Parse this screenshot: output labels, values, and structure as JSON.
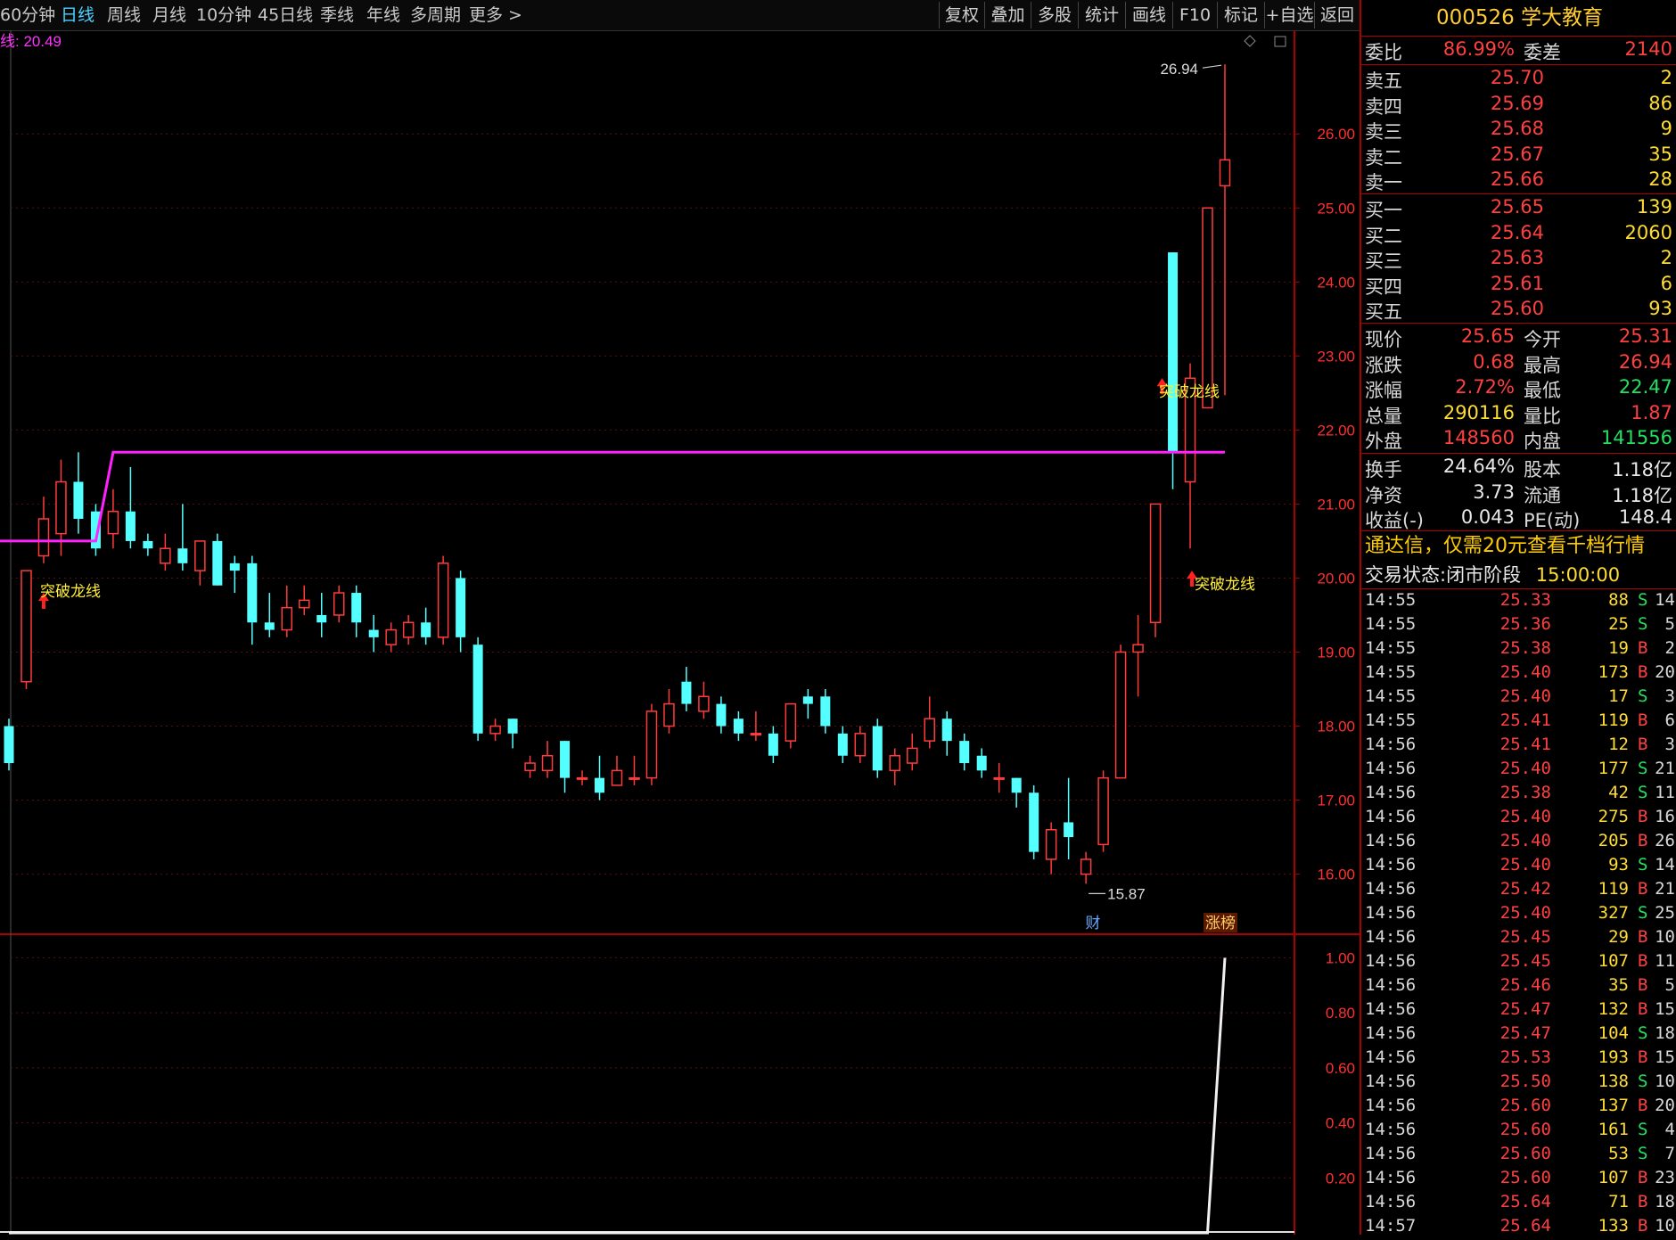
{
  "toolbar": {
    "tabs": [
      "60分钟",
      "日线",
      "周线",
      "月线",
      "10分钟",
      "45日线",
      "季线",
      "年线",
      "多周期",
      "更多 >"
    ],
    "active_tab": "日线",
    "buttons": [
      "复权",
      "叠加",
      "多股",
      "统计",
      "画线",
      "F10",
      "标记",
      "+自选",
      "返回"
    ]
  },
  "overlay_label": "线: 20.49",
  "chart_data": {
    "type": "candlestick",
    "price_axis_ticks": [
      "26.00",
      "25.00",
      "24.00",
      "23.00",
      "22.00",
      "21.00",
      "20.00",
      "19.00",
      "18.00",
      "17.00",
      "16.00"
    ],
    "ylim": [
      15.2,
      27.4
    ],
    "high_label": "26.94",
    "low_label": "15.87",
    "dragon_line_label": "突破龙线",
    "dragon_line": {
      "before": 20.5,
      "after": 21.7
    },
    "candles": [
      [
        18.0,
        17.5,
        18.1,
        17.4
      ],
      [
        18.6,
        20.1,
        20.1,
        18.5
      ],
      [
        20.3,
        20.8,
        21.1,
        20.2
      ],
      [
        20.6,
        21.3,
        21.6,
        20.3
      ],
      [
        21.3,
        20.8,
        21.7,
        20.6
      ],
      [
        20.9,
        20.4,
        21.0,
        20.3
      ],
      [
        20.6,
        20.9,
        21.2,
        20.4
      ],
      [
        20.9,
        20.5,
        21.5,
        20.4
      ],
      [
        20.5,
        20.4,
        20.6,
        20.3
      ],
      [
        20.2,
        20.4,
        20.6,
        20.1
      ],
      [
        20.4,
        20.2,
        21.0,
        20.1
      ],
      [
        20.1,
        20.5,
        20.5,
        19.9
      ],
      [
        20.5,
        19.9,
        20.6,
        19.9
      ],
      [
        20.2,
        20.1,
        20.3,
        19.8
      ],
      [
        20.2,
        19.4,
        20.3,
        19.1
      ],
      [
        19.4,
        19.3,
        19.8,
        19.2
      ],
      [
        19.3,
        19.6,
        19.9,
        19.2
      ],
      [
        19.6,
        19.7,
        19.9,
        19.5
      ],
      [
        19.5,
        19.4,
        19.8,
        19.2
      ],
      [
        19.5,
        19.8,
        19.9,
        19.4
      ],
      [
        19.8,
        19.4,
        19.9,
        19.2
      ],
      [
        19.3,
        19.2,
        19.5,
        19.0
      ],
      [
        19.1,
        19.3,
        19.4,
        19.0
      ],
      [
        19.2,
        19.4,
        19.5,
        19.1
      ],
      [
        19.4,
        19.2,
        19.6,
        19.1
      ],
      [
        19.2,
        20.2,
        20.3,
        19.1
      ],
      [
        20.0,
        19.2,
        20.1,
        19.0
      ],
      [
        19.1,
        17.9,
        19.2,
        17.8
      ],
      [
        17.9,
        18.0,
        18.1,
        17.8
      ],
      [
        18.1,
        17.9,
        18.1,
        17.7
      ],
      [
        17.4,
        17.5,
        17.6,
        17.3
      ],
      [
        17.4,
        17.6,
        17.8,
        17.3
      ],
      [
        17.8,
        17.3,
        17.8,
        17.1
      ],
      [
        17.3,
        17.3,
        17.4,
        17.2
      ],
      [
        17.3,
        17.1,
        17.6,
        17.0
      ],
      [
        17.2,
        17.4,
        17.6,
        17.2
      ],
      [
        17.3,
        17.3,
        17.6,
        17.2
      ],
      [
        17.3,
        18.2,
        18.3,
        17.2
      ],
      [
        18.0,
        18.3,
        18.5,
        17.9
      ],
      [
        18.6,
        18.3,
        18.8,
        18.2
      ],
      [
        18.2,
        18.4,
        18.6,
        18.1
      ],
      [
        18.3,
        18.0,
        18.4,
        17.9
      ],
      [
        18.1,
        17.9,
        18.2,
        17.8
      ],
      [
        17.9,
        17.9,
        18.2,
        17.8
      ],
      [
        17.9,
        17.6,
        18.0,
        17.5
      ],
      [
        17.8,
        18.3,
        18.3,
        17.7
      ],
      [
        18.4,
        18.3,
        18.5,
        18.1
      ],
      [
        18.4,
        18.0,
        18.5,
        17.9
      ],
      [
        17.9,
        17.6,
        18.0,
        17.5
      ],
      [
        17.6,
        17.9,
        18.0,
        17.5
      ],
      [
        18.0,
        17.4,
        18.1,
        17.3
      ],
      [
        17.4,
        17.6,
        17.7,
        17.2
      ],
      [
        17.5,
        17.7,
        17.9,
        17.4
      ],
      [
        17.8,
        18.1,
        18.4,
        17.7
      ],
      [
        18.1,
        17.8,
        18.2,
        17.6
      ],
      [
        17.8,
        17.5,
        17.9,
        17.4
      ],
      [
        17.6,
        17.4,
        17.7,
        17.3
      ],
      [
        17.3,
        17.3,
        17.5,
        17.1
      ],
      [
        17.3,
        17.1,
        17.3,
        16.9
      ],
      [
        17.1,
        16.3,
        17.2,
        16.2
      ],
      [
        16.2,
        16.6,
        16.7,
        16.0
      ],
      [
        16.7,
        16.5,
        17.3,
        16.2
      ],
      [
        16.0,
        16.2,
        16.3,
        15.87
      ],
      [
        16.4,
        17.3,
        17.4,
        16.3
      ],
      [
        17.3,
        19.0,
        19.1,
        17.3
      ],
      [
        19.0,
        19.1,
        19.5,
        18.4
      ],
      [
        19.4,
        21.0,
        21.0,
        19.2
      ],
      [
        24.4,
        21.7,
        24.4,
        21.2
      ],
      [
        21.3,
        22.7,
        22.9,
        20.4
      ],
      [
        22.3,
        25.0,
        25.0,
        22.3
      ],
      [
        25.3,
        25.65,
        26.94,
        22.47
      ]
    ],
    "signals": [
      {
        "candle": 2,
        "label": "突破龙线"
      },
      {
        "candle": 68,
        "label": "突破龙线"
      },
      {
        "candle": 69,
        "label": "突破龙线"
      }
    ],
    "badges": [
      "财",
      "涨榜"
    ],
    "indicator_ticks": [
      "1.00",
      "0.80",
      "0.60",
      "0.40",
      "0.20"
    ],
    "indicator_ylim": [
      0,
      1.05
    ],
    "indicator_values_nonzero": {
      "70": 1.0
    }
  },
  "quote": {
    "title": "000526 学大教育",
    "weibi_label": "委比",
    "weibi": "86.99%",
    "weicha_label": "委差",
    "weicha": "2140",
    "asks": [
      {
        "label": "卖五",
        "price": "25.70",
        "vol": "2"
      },
      {
        "label": "卖四",
        "price": "25.69",
        "vol": "86"
      },
      {
        "label": "卖三",
        "price": "25.68",
        "vol": "9"
      },
      {
        "label": "卖二",
        "price": "25.67",
        "vol": "35"
      },
      {
        "label": "卖一",
        "price": "25.66",
        "vol": "28"
      }
    ],
    "bids": [
      {
        "label": "买一",
        "price": "25.65",
        "vol": "139"
      },
      {
        "label": "买二",
        "price": "25.64",
        "vol": "2060"
      },
      {
        "label": "买三",
        "price": "25.63",
        "vol": "2"
      },
      {
        "label": "买四",
        "price": "25.61",
        "vol": "6"
      },
      {
        "label": "买五",
        "price": "25.60",
        "vol": "93"
      }
    ],
    "stats": [
      {
        "l1": "现价",
        "v1": "25.65",
        "c1": "red",
        "l2": "今开",
        "v2": "25.31",
        "c2": "red"
      },
      {
        "l1": "涨跌",
        "v1": "0.68",
        "c1": "red",
        "l2": "最高",
        "v2": "26.94",
        "c2": "red"
      },
      {
        "l1": "涨幅",
        "v1": "2.72%",
        "c1": "red",
        "l2": "最低",
        "v2": "22.47",
        "c2": "grn"
      },
      {
        "l1": "总量",
        "v1": "290116",
        "c1": "yel",
        "l2": "量比",
        "v2": "1.87",
        "c2": "red"
      },
      {
        "l1": "外盘",
        "v1": "148560",
        "c1": "red",
        "l2": "内盘",
        "v2": "141556",
        "c2": "grn"
      }
    ],
    "stats2": [
      {
        "l1": "换手",
        "v1": "24.64%",
        "l2": "股本",
        "v2": "1.18亿"
      },
      {
        "l1": "净资",
        "v1": "3.73",
        "l2": "流通",
        "v2": "1.18亿"
      },
      {
        "l1": "收益(-)",
        "v1": "0.043",
        "l2": "PE(动)",
        "v2": "148.4"
      }
    ],
    "promo": "通达信，仅需20元查看千档行情",
    "state_label": "交易状态:",
    "state": "闭市阶段",
    "state_time": "15:00:00"
  },
  "ticks": [
    [
      "14:55",
      "25.33",
      "88",
      "S",
      "14"
    ],
    [
      "14:55",
      "25.36",
      "25",
      "S",
      "5"
    ],
    [
      "14:55",
      "25.38",
      "19",
      "B",
      "2"
    ],
    [
      "14:55",
      "25.40",
      "173",
      "B",
      "20"
    ],
    [
      "14:55",
      "25.40",
      "17",
      "S",
      "3"
    ],
    [
      "14:55",
      "25.41",
      "119",
      "B",
      "6"
    ],
    [
      "14:56",
      "25.41",
      "12",
      "B",
      "3"
    ],
    [
      "14:56",
      "25.40",
      "177",
      "S",
      "21"
    ],
    [
      "14:56",
      "25.38",
      "42",
      "S",
      "11"
    ],
    [
      "14:56",
      "25.40",
      "275",
      "B",
      "16"
    ],
    [
      "14:56",
      "25.40",
      "205",
      "B",
      "26"
    ],
    [
      "14:56",
      "25.40",
      "93",
      "S",
      "14"
    ],
    [
      "14:56",
      "25.42",
      "119",
      "B",
      "21"
    ],
    [
      "14:56",
      "25.40",
      "327",
      "S",
      "25"
    ],
    [
      "14:56",
      "25.45",
      "29",
      "B",
      "10"
    ],
    [
      "14:56",
      "25.45",
      "107",
      "B",
      "11"
    ],
    [
      "14:56",
      "25.46",
      "35",
      "B",
      "5"
    ],
    [
      "14:56",
      "25.47",
      "132",
      "B",
      "15"
    ],
    [
      "14:56",
      "25.47",
      "104",
      "S",
      "18"
    ],
    [
      "14:56",
      "25.53",
      "193",
      "B",
      "15"
    ],
    [
      "14:56",
      "25.50",
      "138",
      "S",
      "10"
    ],
    [
      "14:56",
      "25.60",
      "137",
      "B",
      "20"
    ],
    [
      "14:56",
      "25.60",
      "161",
      "S",
      "4"
    ],
    [
      "14:56",
      "25.60",
      "53",
      "S",
      "7"
    ],
    [
      "14:56",
      "25.60",
      "107",
      "B",
      "23"
    ],
    [
      "14:56",
      "25.64",
      "71",
      "B",
      "18"
    ],
    [
      "14:57",
      "25.64",
      "133",
      "B",
      "10"
    ]
  ]
}
